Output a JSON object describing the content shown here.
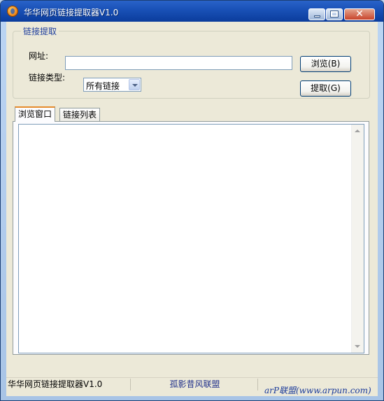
{
  "window": {
    "title": "华华网页链接提取器V1.0",
    "icon": "firefox-like-app-icon",
    "controls": {
      "minimize": "minimize-icon",
      "maximize": "maximize-icon",
      "close": "close-icon",
      "close_glyph": "✕"
    }
  },
  "group": {
    "legend": "链接提取",
    "url_label": "网址:",
    "url_value": "",
    "type_label": "链接类型:",
    "type_selected": "所有链接",
    "browse_button": "浏览(B)",
    "extract_button": "提取(G)"
  },
  "tabs": [
    {
      "label": "浏览窗口",
      "active": true
    },
    {
      "label": "链接列表",
      "active": false
    }
  ],
  "statusbar": {
    "app": "华华网页链接提取器V1.0",
    "author": "孤影昔风联盟",
    "extra": ""
  },
  "watermark": "arP联盟(www.arpun.com)",
  "colors": {
    "title_bar": "#1a52b8",
    "client_bg": "#ece9d8",
    "legend": "#1f3f9e",
    "tab_accent": "#e68b2c"
  }
}
